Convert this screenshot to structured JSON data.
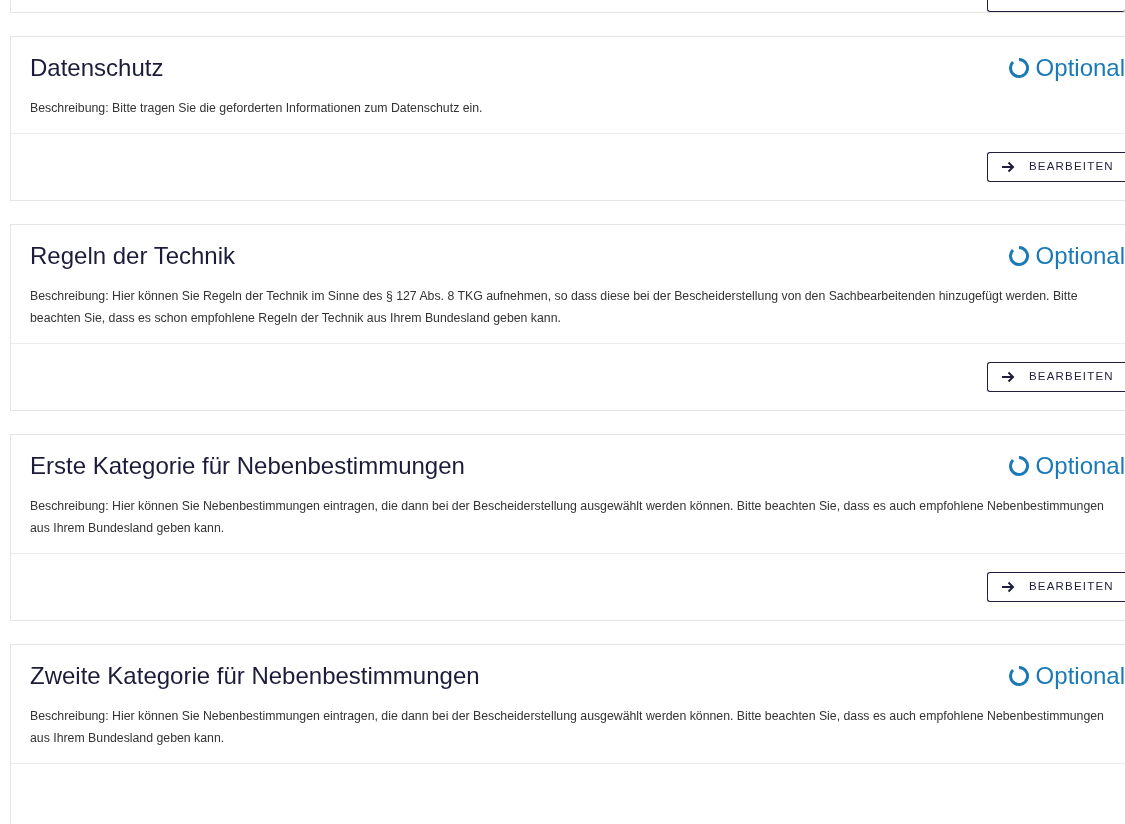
{
  "sections": [
    {
      "title": "Datenschutz",
      "status": {
        "kind": "optional",
        "label": "Optional"
      },
      "description": "Beschreibung: Bitte tragen Sie die geforderten Informationen zum Datenschutz ein.",
      "button": "BEARBEITEN"
    },
    {
      "title": "Regeln der Technik",
      "status": {
        "kind": "optional",
        "label": "Optional"
      },
      "description": "Beschreibung: Hier können Sie Regeln der Technik im Sinne des § 127 Abs. 8 TKG aufnehmen, so dass diese bei der Bescheiderstellung von den Sachbearbeitenden hinzugefügt werden. Bitte beachten Sie, dass es schon empfohlene Regeln der Technik aus Ihrem Bundesland geben kann.",
      "button": "BEARBEITEN"
    },
    {
      "title": "Erste Kategorie für Nebenbestimmungen",
      "status": {
        "kind": "optional",
        "label": "Optional"
      },
      "description": "Beschreibung: Hier können Sie Nebenbestimmungen eintragen, die dann bei der Bescheiderstellung ausgewählt werden können. Bitte beachten Sie, dass es auch empfohlene Nebenbestimmungen aus Ihrem Bundesland geben kann.",
      "button": "BEARBEITEN"
    },
    {
      "title": "Zweite Kategorie für Nebenbestimmungen",
      "status": {
        "kind": "optional",
        "label": "Optional"
      },
      "description": "Beschreibung: Hier können Sie Nebenbestimmungen eintragen, die dann bei der Bescheiderstellung ausgewählt werden können. Bitte beachten Sie, dass es auch empfohlene Nebenbestimmungen aus Ihrem Bundesland geben kann."
    }
  ]
}
